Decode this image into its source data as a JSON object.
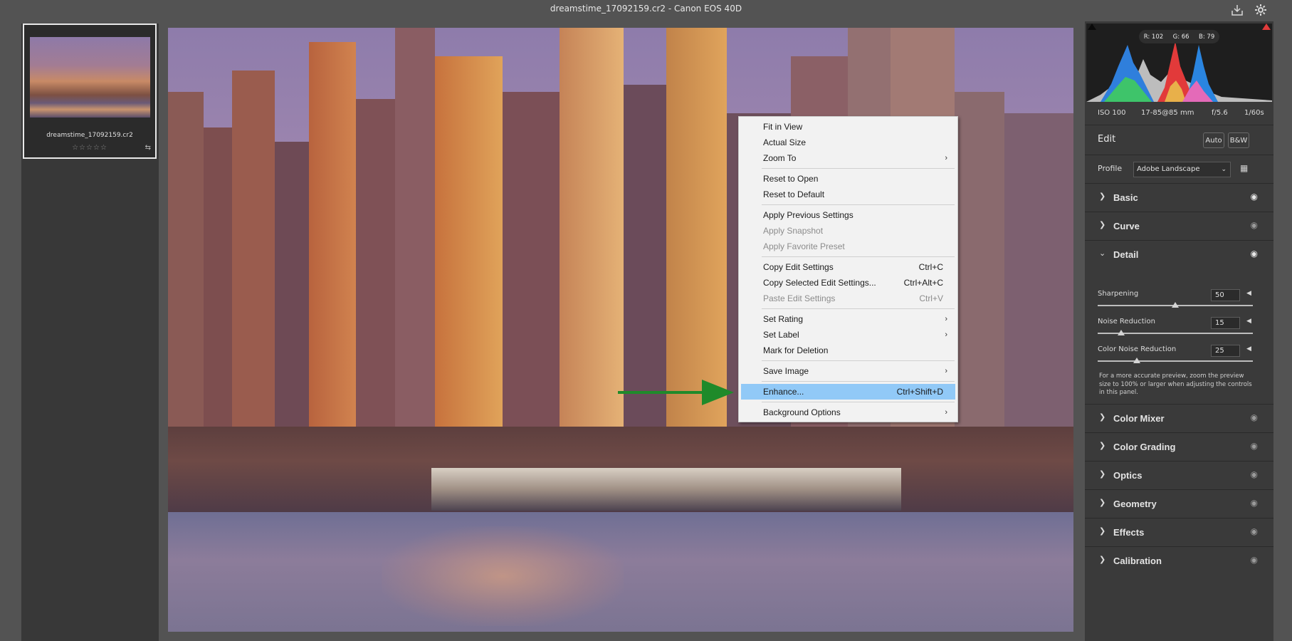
{
  "titlebar": {
    "title": "dreamstime_17092159.cr2  -  Canon EOS 40D"
  },
  "filmstrip": {
    "filename": "dreamstime_17092159.cr2",
    "stars": "☆☆☆☆☆"
  },
  "context_menu": {
    "items": [
      {
        "label": "Fit in View",
        "shortcut": "",
        "submenu": false,
        "disabled": false
      },
      {
        "label": "Actual Size",
        "shortcut": "",
        "submenu": false,
        "disabled": false
      },
      {
        "label": "Zoom To",
        "shortcut": "",
        "submenu": true,
        "disabled": false
      },
      {
        "label": "Reset to Open",
        "shortcut": "",
        "submenu": false,
        "disabled": false
      },
      {
        "label": "Reset to Default",
        "shortcut": "",
        "submenu": false,
        "disabled": false
      },
      {
        "label": "Apply Previous Settings",
        "shortcut": "",
        "submenu": false,
        "disabled": false
      },
      {
        "label": "Apply Snapshot",
        "shortcut": "",
        "submenu": false,
        "disabled": true
      },
      {
        "label": "Apply Favorite Preset",
        "shortcut": "",
        "submenu": false,
        "disabled": true
      },
      {
        "label": "Copy Edit Settings",
        "shortcut": "Ctrl+C",
        "submenu": false,
        "disabled": false
      },
      {
        "label": "Copy Selected Edit Settings...",
        "shortcut": "Ctrl+Alt+C",
        "submenu": false,
        "disabled": false
      },
      {
        "label": "Paste Edit Settings",
        "shortcut": "Ctrl+V",
        "submenu": false,
        "disabled": true
      },
      {
        "label": "Set Rating",
        "shortcut": "",
        "submenu": true,
        "disabled": false
      },
      {
        "label": "Set Label",
        "shortcut": "",
        "submenu": true,
        "disabled": false
      },
      {
        "label": "Mark for Deletion",
        "shortcut": "",
        "submenu": false,
        "disabled": false
      },
      {
        "label": "Save Image",
        "shortcut": "",
        "submenu": true,
        "disabled": false
      },
      {
        "label": "Enhance...",
        "shortcut": "Ctrl+Shift+D",
        "submenu": false,
        "disabled": false,
        "highlighted": true
      },
      {
        "label": "Background Options",
        "shortcut": "",
        "submenu": true,
        "disabled": false
      }
    ]
  },
  "histogram": {
    "r": "R: 102",
    "g": "G: 66",
    "b": "B: 79"
  },
  "camera_info": {
    "iso": "ISO 100",
    "lens": "17-85@85 mm",
    "aperture": "f/5.6",
    "shutter": "1/60s"
  },
  "edit": {
    "title": "Edit",
    "auto_label": "Auto",
    "bw_label": "B&W"
  },
  "profile": {
    "label": "Profile",
    "value": "Adobe Landscape"
  },
  "sections": {
    "basic": "Basic",
    "curve": "Curve",
    "detail": "Detail",
    "color_mixer": "Color Mixer",
    "color_grading": "Color Grading",
    "optics": "Optics",
    "geometry": "Geometry",
    "effects": "Effects",
    "calibration": "Calibration"
  },
  "detail": {
    "sharpening": {
      "label": "Sharpening",
      "value": "50",
      "level": 0.5
    },
    "noise_reduction": {
      "label": "Noise Reduction",
      "value": "15",
      "level": 0.15
    },
    "color_noise_reduction": {
      "label": "Color Noise Reduction",
      "value": "25",
      "level": 0.25
    },
    "note": "For a more accurate preview, zoom the preview size to 100% or larger when adjusting the controls in this panel."
  },
  "colors": {
    "accent_highlight": "#91c9f7",
    "arrow": "#1f8a2a"
  }
}
